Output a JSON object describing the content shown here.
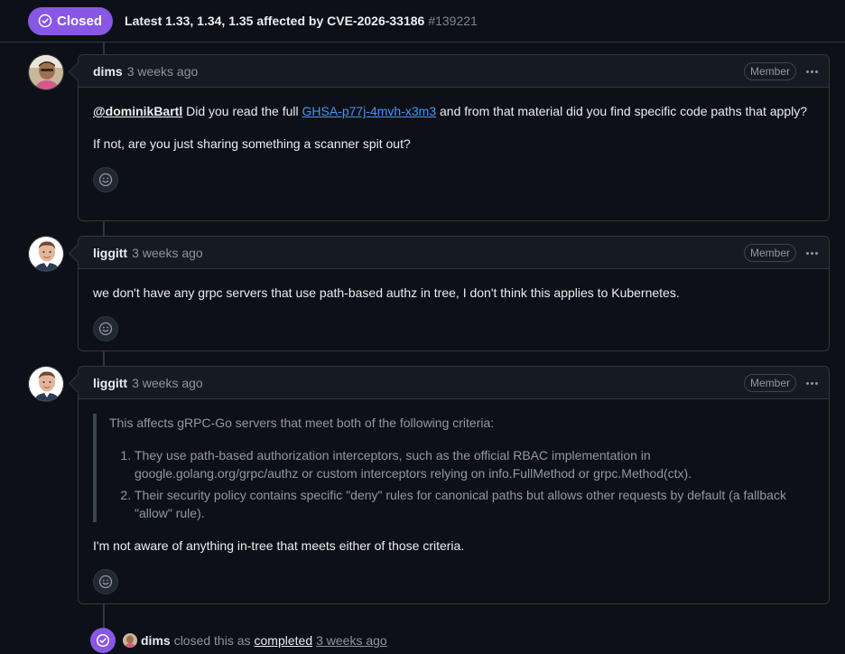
{
  "header": {
    "state": "Closed",
    "title": "Latest 1.33, 1.34, 1.35 affected by CVE-2026-33186",
    "number": "#139221"
  },
  "comments": [
    {
      "author": "dims",
      "time": "3 weeks ago",
      "role": "Member",
      "mention": "@dominikBartl",
      "text_a": " Did you read the full ",
      "link": "GHSA-p77j-4mvh-x3m3",
      "text_b": " and from that material did you find specific code paths that apply?",
      "para2": "If not, are you just sharing something a scanner spit out?"
    },
    {
      "author": "liggitt",
      "time": "3 weeks ago",
      "role": "Member",
      "para1": "we don't have any grpc servers that use path-based authz in tree, I don't think this applies to Kubernetes."
    },
    {
      "author": "liggitt",
      "time": "3 weeks ago",
      "role": "Member",
      "quote_intro": "This affects gRPC-Go servers that meet both of the following criteria:",
      "quote_items": [
        "They use path-based authorization interceptors, such as the official RBAC implementation in google.golang.org/grpc/authz or custom interceptors relying on info.FullMethod or grpc.Method(ctx).",
        "Their security policy contains specific \"deny\" rules for canonical paths but allows other requests by default (a fallback \"allow\" rule)."
      ],
      "para1": "I'm not aware of anything in-tree that meets either of those criteria."
    }
  ],
  "event": {
    "author": "dims",
    "action": "closed this as",
    "reason": "completed",
    "time": "3 weeks ago"
  },
  "colors": {
    "closed_purple": "#8957e5",
    "link_blue": "#4493f8",
    "background": "#0d1117"
  },
  "icons": [
    "check-circle-icon",
    "smiley-icon",
    "kebab-horizontal-icon"
  ]
}
